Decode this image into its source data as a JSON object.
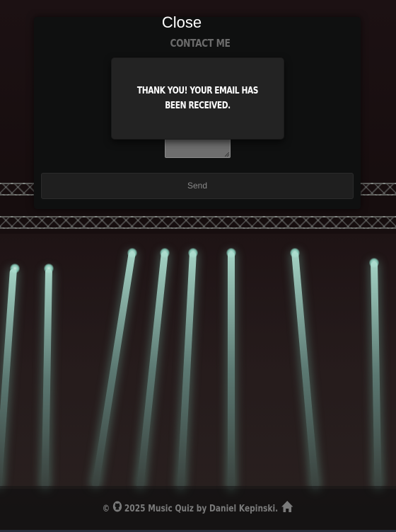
{
  "modal": {
    "close_label": "Close",
    "heading": "Contact me",
    "send_label": "Send"
  },
  "toast": {
    "message": "Thank you! Your email has been received."
  },
  "footer": {
    "copyright_symbol": "©",
    "text": "2025 Music Quiz by Daniel Kepinski."
  },
  "icons": {
    "github": "github-icon",
    "home": "home-icon"
  },
  "colors": {
    "modal_bg": "#0f1010",
    "toast_bg": "#232323",
    "heading": "#6b6b6b",
    "footer_text": "#7a7a7a"
  }
}
